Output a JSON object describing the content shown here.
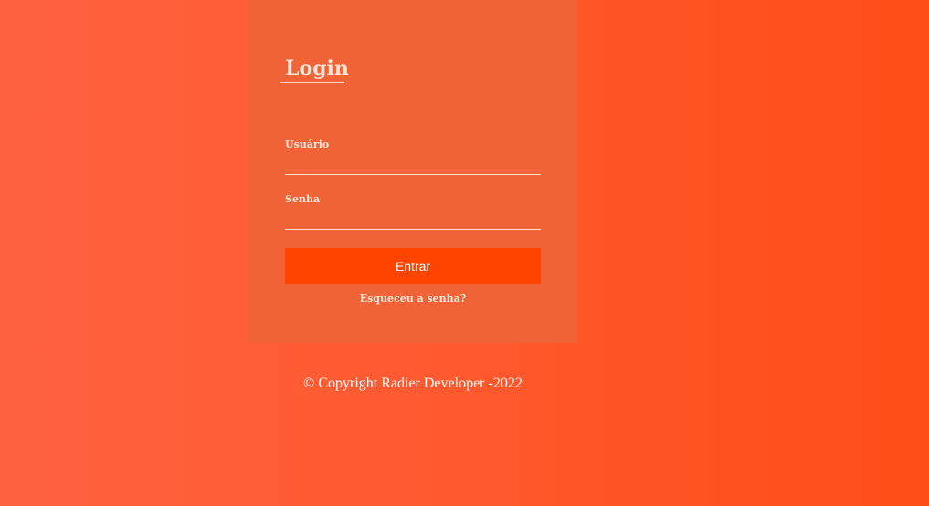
{
  "login": {
    "title": "Login",
    "username_label": "Usuário",
    "username_value": "",
    "password_label": "Senha",
    "password_value": "",
    "submit_label": "Entrar",
    "forgot_password": "Esqueceu a senha?"
  },
  "footer": {
    "copyright": "© Copyright Radier Developer -2022"
  },
  "colors": {
    "background_start": "#ff6240",
    "background_end": "#ff4d16",
    "card": "#f06336",
    "button": "#ff4400",
    "text_light": "#ffe6da"
  }
}
